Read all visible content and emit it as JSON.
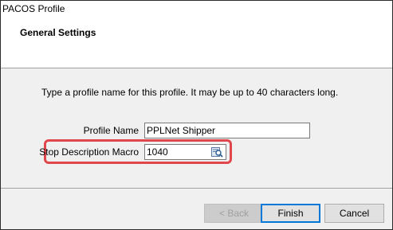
{
  "window": {
    "title": "PACOS Profile"
  },
  "header": {
    "section_title": "General Settings"
  },
  "main": {
    "instructions": "Type a profile name for this profile. It may be up to 40 characters long.",
    "profile_name": {
      "label": "Profile Name",
      "value": "PPLNet Shipper"
    },
    "stop_description_macro": {
      "label": "Stop Description Macro",
      "value": "1040",
      "icon": "macro-editor-icon"
    },
    "highlight_color": "#e0474c"
  },
  "buttons": {
    "back": "< Back",
    "finish": "Finish",
    "cancel": "Cancel"
  }
}
